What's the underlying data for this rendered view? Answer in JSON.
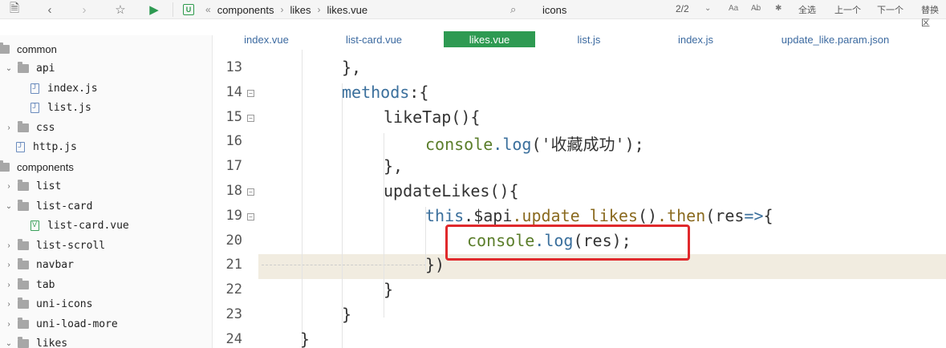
{
  "breadcrumb": [
    "components",
    "likes",
    "likes.vue"
  ],
  "search": {
    "value": "icons",
    "match": "2/2"
  },
  "toolbar": {
    "select_all": "全选",
    "prev": "上一个",
    "next": "下一个",
    "replace": "替换区",
    "aa": "Aa",
    "ab": "A̶b",
    "star": "✱"
  },
  "sidebar": [
    {
      "label": "common",
      "indent": 0,
      "type": "folder-plain"
    },
    {
      "label": "api",
      "indent": 0,
      "type": "folder-open"
    },
    {
      "label": "index.js",
      "indent": 2,
      "type": "file"
    },
    {
      "label": "list.js",
      "indent": 2,
      "type": "file"
    },
    {
      "label": "css",
      "indent": 0,
      "type": "folder-closed"
    },
    {
      "label": "http.js",
      "indent": 0,
      "type": "file"
    },
    {
      "label": "components",
      "indent": -1,
      "type": "root"
    },
    {
      "label": "list",
      "indent": 0,
      "type": "folder-closed"
    },
    {
      "label": "list-card",
      "indent": 0,
      "type": "folder-open"
    },
    {
      "label": "list-card.vue",
      "indent": 2,
      "type": "vfile"
    },
    {
      "label": "list-scroll",
      "indent": 0,
      "type": "folder-closed"
    },
    {
      "label": "navbar",
      "indent": 0,
      "type": "folder-closed"
    },
    {
      "label": "tab",
      "indent": 0,
      "type": "folder-closed"
    },
    {
      "label": "uni-icons",
      "indent": 0,
      "type": "folder-closed"
    },
    {
      "label": "uni-load-more",
      "indent": 0,
      "type": "folder-closed"
    },
    {
      "label": "likes",
      "indent": 0,
      "type": "folder-open"
    }
  ],
  "tabs": [
    {
      "label": "index.vue",
      "active": false
    },
    {
      "label": "list-card.vue",
      "active": false
    },
    {
      "label": "likes.vue",
      "active": true
    },
    {
      "label": "list.js",
      "active": false
    },
    {
      "label": "index.js",
      "active": false
    },
    {
      "label": "update_like.param.json",
      "active": false
    }
  ],
  "code_lines": [
    {
      "no": "13",
      "fold": false,
      "text": "},",
      "col": 1
    },
    {
      "no": "14",
      "fold": true,
      "text": "methods:{",
      "col": 1
    },
    {
      "no": "15",
      "fold": true,
      "text": "likeTap(){",
      "col": 2
    },
    {
      "no": "16",
      "fold": false,
      "text": "console.log('收藏成功');",
      "col": 3
    },
    {
      "no": "17",
      "fold": false,
      "text": "},",
      "col": 2
    },
    {
      "no": "18",
      "fold": true,
      "text": "updateLikes(){",
      "col": 2
    },
    {
      "no": "19",
      "fold": true,
      "text": "this.$api.update_likes().then(res=>{",
      "col": 3
    },
    {
      "no": "20",
      "fold": false,
      "text": "console.log(res);",
      "col": 4
    },
    {
      "no": "21",
      "fold": false,
      "text": "})",
      "col": 3
    },
    {
      "no": "22",
      "fold": false,
      "text": "}",
      "col": 2
    },
    {
      "no": "23",
      "fold": false,
      "text": "}",
      "col": 1
    },
    {
      "no": "24",
      "fold": false,
      "text": "}",
      "col": 0
    }
  ],
  "accent_color": "#2e9a52",
  "highlight_color": "#e0292c"
}
